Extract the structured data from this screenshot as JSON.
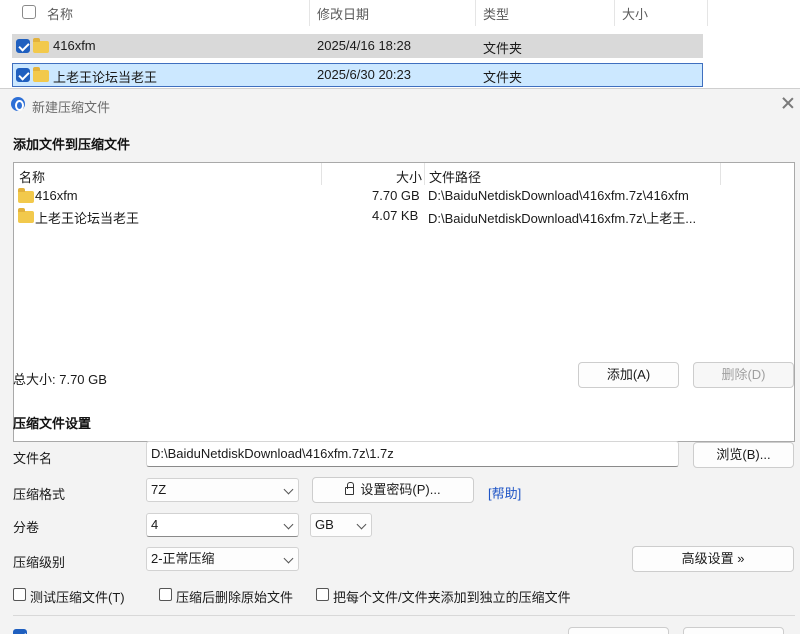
{
  "explorer": {
    "columns": {
      "name": "名称",
      "modified": "修改日期",
      "type": "类型",
      "size": "大小"
    },
    "rows": [
      {
        "name": "416xfm",
        "modified": "2025/4/16 18:28",
        "type": "文件夹"
      },
      {
        "name": "上老王论坛当老王",
        "modified": "2025/6/30 20:23",
        "type": "文件夹"
      }
    ]
  },
  "dialog": {
    "title": "新建压缩文件",
    "add_section_title": "添加文件到压缩文件",
    "list": {
      "headers": {
        "name": "名称",
        "size": "大小",
        "path": "文件路径"
      },
      "rows": [
        {
          "name": "416xfm",
          "size": "7.70 GB",
          "path": "D:\\BaiduNetdiskDownload\\416xfm.7z\\416xfm"
        },
        {
          "name": "上老王论坛当老王",
          "size": "4.07 KB",
          "path": "D:\\BaiduNetdiskDownload\\416xfm.7z\\上老王..."
        }
      ]
    },
    "total_size": "总大小: 7.70 GB",
    "add_button": "添加(A)",
    "delete_button": "删除(D)",
    "settings_title": "压缩文件设置",
    "filename_label": "文件名",
    "filename_value": "D:\\BaiduNetdiskDownload\\416xfm.7z\\1.7z",
    "browse_button": "浏览(B)...",
    "format_label": "压缩格式",
    "format_value": "7Z",
    "password_button": "设置密码(P)...",
    "help_link": "[帮助]",
    "split_label": "分卷",
    "split_value": "4",
    "split_unit": "GB",
    "level_label": "压缩级别",
    "level_value": "2-正常压缩",
    "advanced_button": "高级设置 »",
    "options": {
      "test": "测试压缩文件(T)",
      "delete_after": "压缩后删除原始文件",
      "separate": "把每个文件/文件夹添加到独立的压缩文件"
    }
  }
}
